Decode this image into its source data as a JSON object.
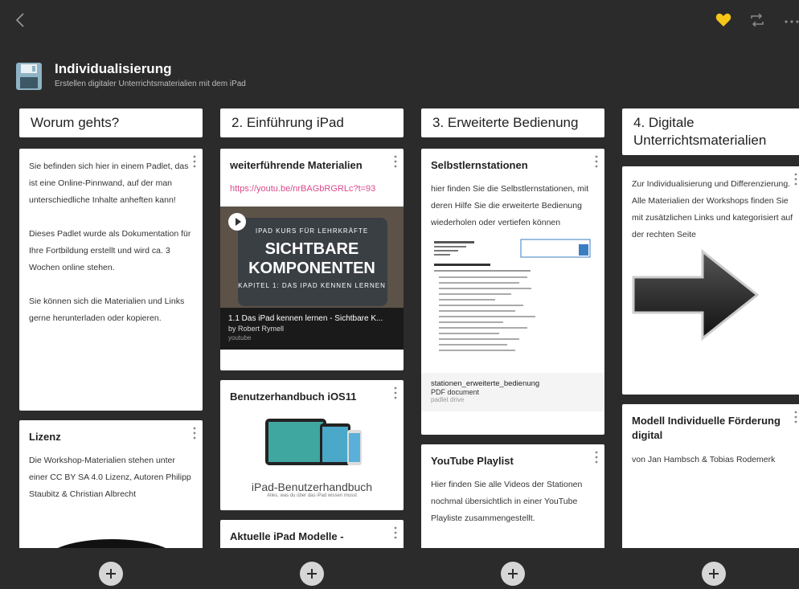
{
  "header": {
    "title": "Individualisierung",
    "subtitle": "Erstellen digitaler Unterrichtsmaterialien mit dem iPad"
  },
  "colors": {
    "heart": "#f5c518",
    "link": "#d94a8c",
    "background": "#2b2b2b"
  },
  "icons": [
    "back-icon",
    "heart-icon",
    "remake-icon",
    "more-icon",
    "floppy-disk-icon",
    "kebab-icon",
    "add-icon",
    "play-icon",
    "arrow-right-icon"
  ],
  "columns": [
    {
      "title": "Worum gehts?",
      "cards": [
        {
          "text": "Sie befinden sich hier in einem Padlet, das ist eine Online-Pinnwand, auf der man unterschiedliche Inhalte anheften kann!\n\nDieses Padlet wurde als Dokumentation für Ihre Fortbildung erstellt und wird ca. 3 Wochen online stehen.\n\nSie können sich die Materialien und Links gerne herunterladen oder kopieren."
        },
        {
          "title": "Lizenz",
          "text": "Die Workshop-Materialien stehen unter einer CC BY SA 4.0 Lizenz, Autoren Philipp Staubitz & Christian Albrecht"
        }
      ]
    },
    {
      "title": "2. Einführung iPad",
      "cards": [
        {
          "title": "weiterführende Materialien",
          "link": "https://youtu.be/nrBAGbRGRLc?t=93",
          "video": {
            "overlay_top": "IPAD KURS FÜR LEHRKRÄFTE",
            "overlay_big1": "SICHTBARE",
            "overlay_big2": "KOMPONENTEN",
            "overlay_bottom": "KAPITEL 1: DAS IPAD KENNEN LERNEN",
            "title": "1.1 Das iPad kennen lernen - Sichtbare K...",
            "author": "by Robert Rymell",
            "source": "youtube"
          }
        },
        {
          "title": "Benutzerhandbuch iOS11",
          "image_title": "iPad-Benutzerhandbuch",
          "image_sub": "Alles, was du über das iPad wissen musst"
        },
        {
          "title": "Aktuelle iPad Modelle -"
        }
      ]
    },
    {
      "title": "3. Erweiterte Bedienung",
      "cards": [
        {
          "title": "Selbstlernstationen",
          "text": "hier finden Sie die Selbstlernstationen, mit deren Hilfe Sie die erweiterte Bedienung wiederholen oder vertiefen können",
          "file": {
            "name": "stationen_erweiterte_bedienung",
            "type": "PDF document",
            "source": "padlet drive"
          }
        },
        {
          "title": "YouTube Playlist",
          "text": "Hier finden Sie alle Videos der Stationen nochmal übersichtlich in einer YouTube Playliste zusammengestellt."
        }
      ]
    },
    {
      "title": "4. Digitale Unterrichtsmaterialien",
      "cards": [
        {
          "text": "Zur Individualisierung und Differenzierung.\nAlle Materialien der Workshops finden Sie mit zusätzlichen Links und kategorisiert auf der rechten Seite"
        },
        {
          "title": "Modell Individuelle Förderung digital",
          "text": "von Jan Hambsch & Tobias Rodemerk"
        }
      ]
    }
  ]
}
